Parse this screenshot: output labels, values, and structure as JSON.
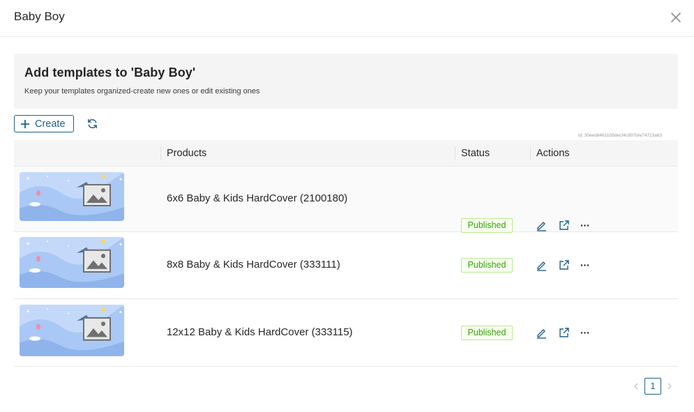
{
  "modal": {
    "title": "Baby Boy"
  },
  "banner": {
    "title": "Add templates to 'Baby Boy'",
    "subtitle": "Keep your templates organized-create new ones or edit existing ones"
  },
  "toolbar": {
    "create_label": "Create"
  },
  "id_label": "id: 30eed8461b35decf4c897bfe74723a63",
  "table": {
    "headers": {
      "products": "Products",
      "status": "Status",
      "actions": "Actions"
    },
    "rows": [
      {
        "product": "6x6 Baby & Kids HardCover (2100180)",
        "status": "Published"
      },
      {
        "product": "8x8 Baby & Kids HardCover (333111)",
        "status": "Published"
      },
      {
        "product": "12x12 Baby & Kids HardCover (333115)",
        "status": "Published"
      }
    ]
  },
  "pagination": {
    "current_page": "1"
  },
  "colors": {
    "accent": "#1f5f8c",
    "status_green": "#389e0d",
    "banner_bg": "#f4f4f4"
  },
  "icons": [
    "close-icon",
    "plus-icon",
    "refresh-icon",
    "edit-icon",
    "external-link-icon",
    "more-icon",
    "chevron-left-icon",
    "chevron-right-icon"
  ]
}
